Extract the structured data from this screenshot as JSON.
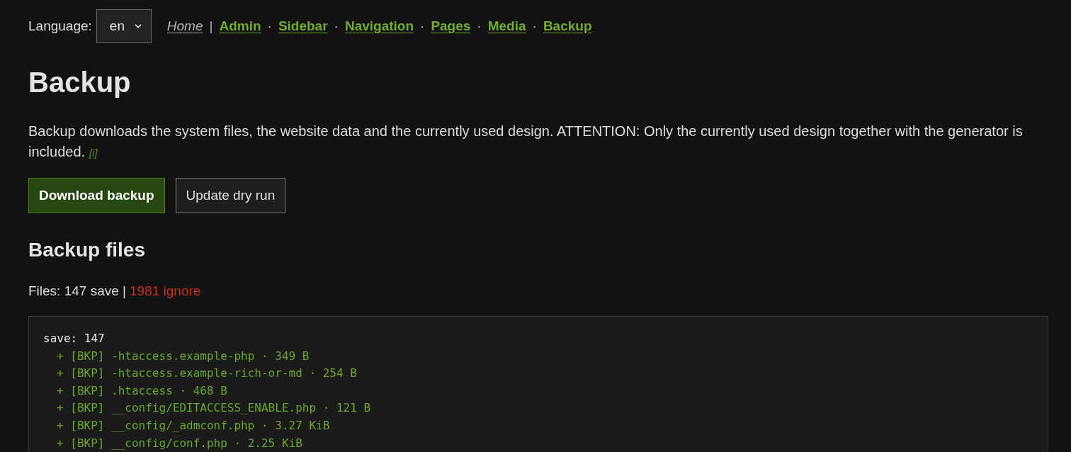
{
  "language": {
    "label": "Language:",
    "value": "en"
  },
  "breadcrumb": [
    {
      "label": "Home",
      "kind": "home",
      "separator": "|"
    },
    {
      "label": "Admin",
      "kind": "link",
      "separator": "·"
    },
    {
      "label": "Sidebar",
      "kind": "link",
      "separator": "·"
    },
    {
      "label": "Navigation",
      "kind": "link",
      "separator": "·"
    },
    {
      "label": "Pages",
      "kind": "link",
      "separator": "·"
    },
    {
      "label": "Media",
      "kind": "link",
      "separator": "·"
    },
    {
      "label": "Backup",
      "kind": "link"
    }
  ],
  "title": "Backup",
  "description": {
    "text": "Backup downloads the system files, the website data and the currently used design. ATTENTION: Only the currently used design together with the generator is included.",
    "info_link": "[i]"
  },
  "buttons": [
    {
      "label": "Download backup",
      "kind": "primary"
    },
    {
      "label": "Update dry run",
      "kind": "secondary"
    }
  ],
  "files_section": {
    "title": "Backup files",
    "summary": {
      "save": "Files: 147 save |",
      "ignore": "1981 ignore"
    },
    "log": {
      "header": "save: 147",
      "lines": [
        "+ [BKP] -htaccess.example-php · 349 B",
        "+ [BKP] -htaccess.example-rich-or-md · 254 B",
        "+ [BKP] .htaccess · 468 B",
        "+ [BKP] __config/EDITACCESS_ENABLE.php · 121 B",
        "+ [BKP] __config/_admconf.php · 3.27 KiB",
        "+ [BKP] __config/conf.php · 2.25 KiB"
      ]
    }
  }
}
